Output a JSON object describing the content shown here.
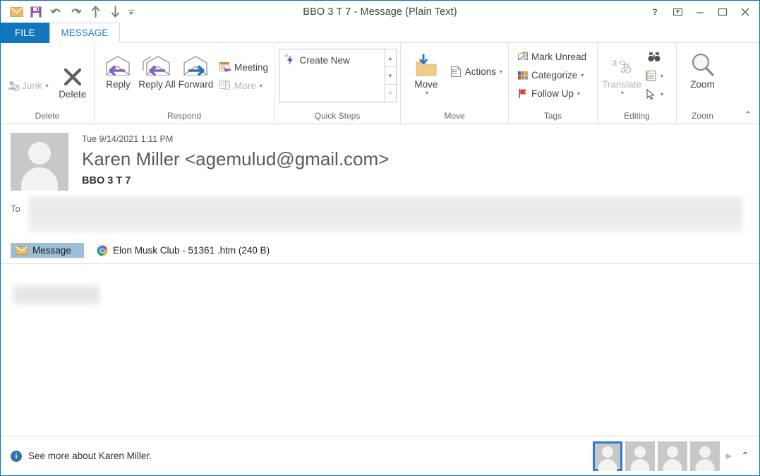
{
  "window": {
    "title": "BBO 3 T 7 - Message (Plain Text)",
    "accent_color": "#0072c6",
    "file_tab_color": "#1176bc"
  },
  "quick_access_toolbar": {
    "items": [
      {
        "name": "envelope-icon",
        "tooltip": "Outlook"
      },
      {
        "name": "save-icon",
        "tooltip": "Save"
      },
      {
        "name": "undo-icon",
        "tooltip": "Undo"
      },
      {
        "name": "redo-icon",
        "tooltip": "Redo"
      },
      {
        "name": "previous-item-icon",
        "tooltip": "Previous Item"
      },
      {
        "name": "next-item-icon",
        "tooltip": "Next Item"
      },
      {
        "name": "customize-qat-icon",
        "tooltip": "Customize Quick Access Toolbar"
      }
    ]
  },
  "window_controls": {
    "help": "?",
    "restore_down": "⬆",
    "minimize": "—",
    "maximize": "□",
    "close": "✕"
  },
  "tabs": [
    {
      "label": "FILE",
      "active": false,
      "style": "file"
    },
    {
      "label": "MESSAGE",
      "active": true,
      "style": "normal"
    }
  ],
  "ribbon": {
    "groups": [
      {
        "label": "Delete",
        "controls": [
          {
            "label": "Junk",
            "type": "small",
            "disabled": true,
            "caret": true
          },
          {
            "label": "Delete",
            "type": "big",
            "disabled": false
          }
        ]
      },
      {
        "label": "Respond",
        "controls": [
          {
            "label": "Reply",
            "type": "big"
          },
          {
            "label": "Reply All",
            "type": "big"
          },
          {
            "label": "Forward",
            "type": "big"
          },
          {
            "label": "Meeting",
            "type": "small"
          },
          {
            "label": "More",
            "type": "small",
            "disabled": true,
            "caret": true
          }
        ]
      },
      {
        "label": "Quick Steps",
        "has_dialog_launcher": true,
        "gallery_items": [
          "Create New"
        ]
      },
      {
        "label": "Move",
        "controls": [
          {
            "label": "Move",
            "type": "big",
            "caret": true
          },
          {
            "label": "Actions",
            "type": "small",
            "caret": true
          }
        ]
      },
      {
        "label": "Tags",
        "has_dialog_launcher": true,
        "controls": [
          {
            "label": "Mark Unread",
            "type": "small"
          },
          {
            "label": "Categorize",
            "type": "small",
            "caret": true
          },
          {
            "label": "Follow Up",
            "type": "small",
            "caret": true
          }
        ]
      },
      {
        "label": "Editing",
        "controls": [
          {
            "label": "Translate",
            "type": "big",
            "disabled": true,
            "caret": true
          },
          {
            "label": "Find",
            "type": "icon"
          },
          {
            "label": "Select",
            "type": "icon",
            "caret": true
          },
          {
            "label": "Pointer",
            "type": "icon",
            "caret": true
          }
        ]
      },
      {
        "label": "Zoom",
        "controls": [
          {
            "label": "Zoom",
            "type": "big"
          }
        ]
      }
    ],
    "collapse_label": "⌃"
  },
  "message": {
    "date": "Tue 9/14/2021 1:11 PM",
    "from": "Karen Miller <agemulud@gmail.com>",
    "subject": "BBO 3 T 7",
    "to_label": "To",
    "to_value": "",
    "body_text": ""
  },
  "attachments_bar": {
    "message_tab_label": "Message",
    "attachments": [
      {
        "icon": "chrome-icon",
        "name": "Elon Musk Club - 51361 .htm (240 B)"
      }
    ]
  },
  "status_bar": {
    "info_icon": "i",
    "text": "See more about Karen Miller.",
    "people": [
      {
        "name": "person-avatar-1",
        "selected": true
      },
      {
        "name": "person-avatar-2",
        "selected": false
      },
      {
        "name": "person-avatar-3",
        "selected": false
      },
      {
        "name": "person-avatar-4",
        "selected": false
      }
    ],
    "next_arrow": "▶",
    "expand_arrow": "⌃"
  }
}
